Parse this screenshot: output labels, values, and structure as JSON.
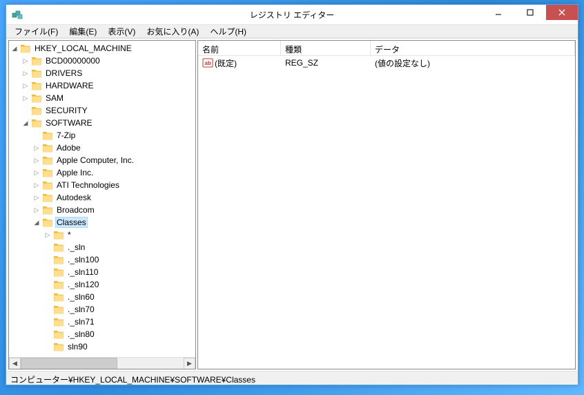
{
  "titlebar": {
    "title": "レジストリ エディター"
  },
  "menubar": {
    "items": [
      {
        "label": "ファイル(F)"
      },
      {
        "label": "編集(E)"
      },
      {
        "label": "表示(V)"
      },
      {
        "label": "お気に入り(A)"
      },
      {
        "label": "ヘルプ(H)"
      }
    ]
  },
  "tree": {
    "root": "HKEY_LOCAL_MACHINE",
    "children_l1": [
      {
        "label": "BCD00000000",
        "exp": "closed"
      },
      {
        "label": "DRIVERS",
        "exp": "closed"
      },
      {
        "label": "HARDWARE",
        "exp": "closed"
      },
      {
        "label": "SAM",
        "exp": "closed"
      },
      {
        "label": "SECURITY",
        "exp": "none"
      },
      {
        "label": "SOFTWARE",
        "exp": "open"
      }
    ],
    "software_children": [
      {
        "label": "7-Zip",
        "exp": "none"
      },
      {
        "label": "Adobe",
        "exp": "closed"
      },
      {
        "label": "Apple Computer, Inc.",
        "exp": "closed"
      },
      {
        "label": "Apple Inc.",
        "exp": "closed"
      },
      {
        "label": "ATI Technologies",
        "exp": "closed"
      },
      {
        "label": "Autodesk",
        "exp": "closed"
      },
      {
        "label": "Broadcom",
        "exp": "closed"
      },
      {
        "label": "Classes",
        "exp": "open",
        "selected": true
      }
    ],
    "classes_children": [
      {
        "label": "*",
        "exp": "closed"
      },
      {
        "label": "._sln",
        "exp": "none"
      },
      {
        "label": "._sln100",
        "exp": "none"
      },
      {
        "label": "._sln110",
        "exp": "none"
      },
      {
        "label": "._sln120",
        "exp": "none"
      },
      {
        "label": "._sln60",
        "exp": "none"
      },
      {
        "label": "._sln70",
        "exp": "none"
      },
      {
        "label": "._sln71",
        "exp": "none"
      },
      {
        "label": "._sln80",
        "exp": "none"
      },
      {
        "label": "  sln90",
        "exp": "none"
      }
    ]
  },
  "list": {
    "columns": {
      "c1": "名前",
      "c2": "種類",
      "c3": "データ"
    },
    "rows": [
      {
        "name": "(既定)",
        "type": "REG_SZ",
        "data": "(値の設定なし)"
      }
    ]
  },
  "statusbar": {
    "path": "コンピューター¥HKEY_LOCAL_MACHINE¥SOFTWARE¥Classes"
  }
}
